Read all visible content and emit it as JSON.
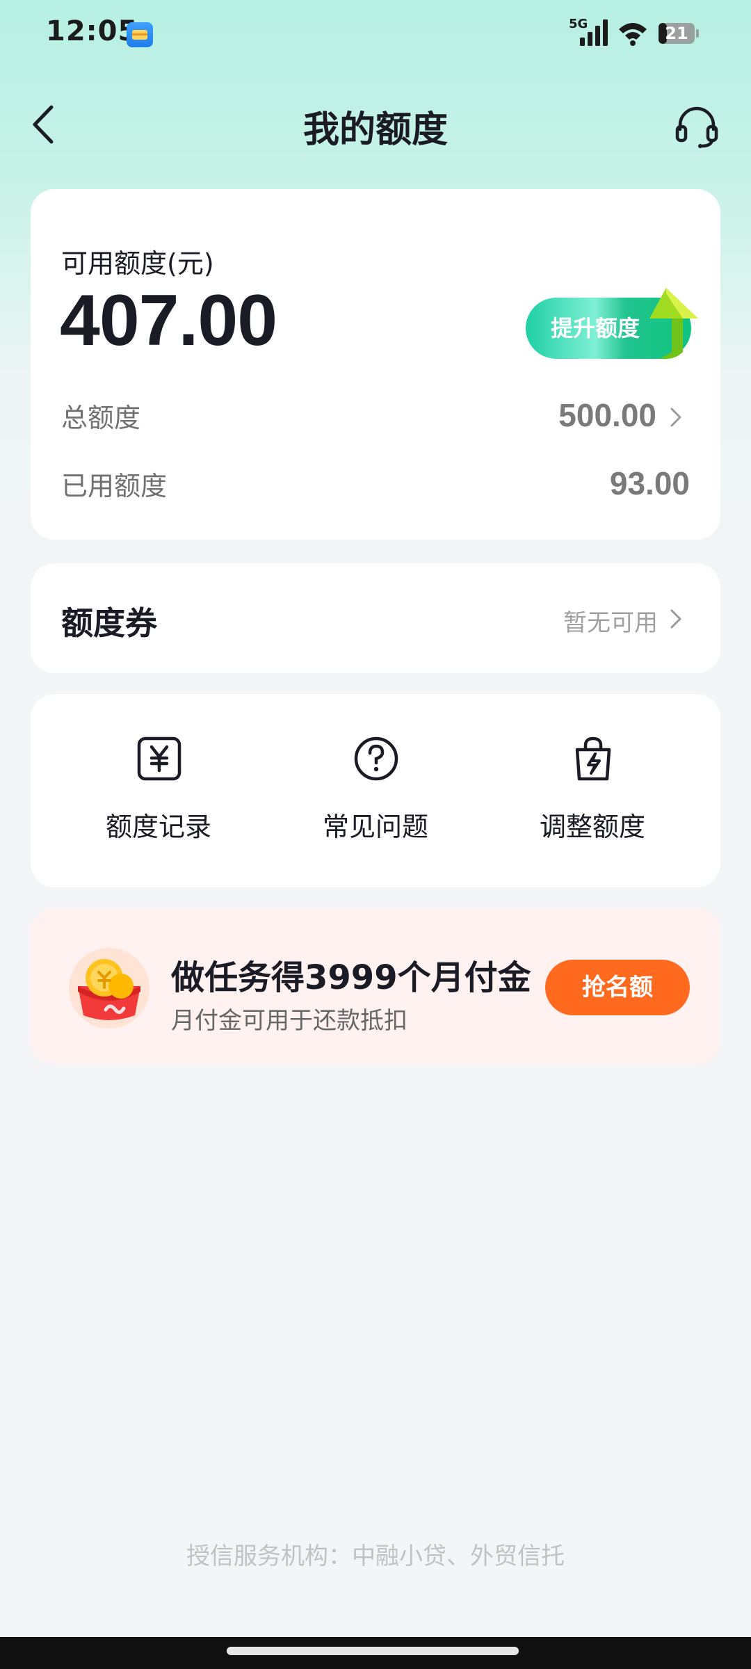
{
  "status_bar": {
    "time": "12:05",
    "network": "5G",
    "battery": "21",
    "icons": [
      "wallet-app-icon",
      "signal-icon",
      "wifi-icon",
      "battery-icon"
    ]
  },
  "header": {
    "title": "我的额度",
    "back_icon": "chevron-left-icon",
    "service_icon": "headset-icon"
  },
  "limit_card": {
    "available_label": "可用额度(元)",
    "available_amount": "407.00",
    "raise_button": "提升额度",
    "total_label": "总额度",
    "total_value": "500.00",
    "used_label": "已用额度",
    "used_value": "93.00"
  },
  "coupon": {
    "label": "额度券",
    "status": "暂无可用"
  },
  "shortcuts": [
    {
      "label": "额度记录",
      "icon": "yuan-record-icon"
    },
    {
      "label": "常见问题",
      "icon": "question-circle-icon"
    },
    {
      "label": "调整额度",
      "icon": "bag-lightning-icon"
    }
  ],
  "promo": {
    "title": "做任务得3999个月付金",
    "subtitle": "月付金可用于还款抵扣",
    "button": "抢名额",
    "icon": "coin-red-envelope-icon"
  },
  "footer": {
    "text": "授信服务机构：中融小贷、外贸信托"
  },
  "colors": {
    "accent_green": "#1fcfa5",
    "promo_orange": "#ff6a1f",
    "background_top": "#b7f0e3",
    "background": "#f4f5f7"
  }
}
